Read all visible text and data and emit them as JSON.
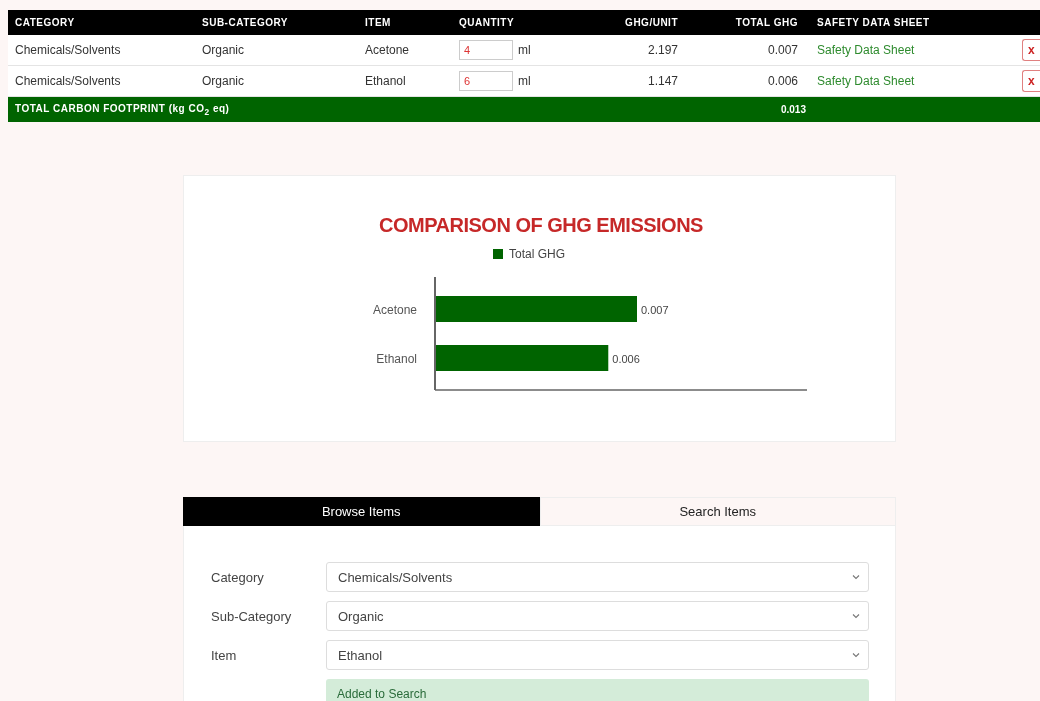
{
  "table": {
    "columns": [
      "CATEGORY",
      "SUB-CATEGORY",
      "ITEM",
      "QUANTITY",
      "GHG/UNIT",
      "TOTAL GHG",
      "SAFETY DATA SHEET"
    ],
    "rows": [
      {
        "category": "Chemicals/Solvents",
        "sub_category": "Organic",
        "item": "Acetone",
        "quantity": "4",
        "unit": "ml",
        "ghg_unit": "2.197",
        "total_ghg": "0.007",
        "sds_link": "Safety Data Sheet",
        "delete": "x"
      },
      {
        "category": "Chemicals/Solvents",
        "sub_category": "Organic",
        "item": "Ethanol",
        "quantity": "6",
        "unit": "ml",
        "ghg_unit": "1.147",
        "total_ghg": "0.006",
        "sds_link": "Safety Data Sheet",
        "delete": "x"
      }
    ],
    "total": {
      "label": "TOTAL CARBON FOOTPRINT (kg CO$_{2}$ eq)",
      "value": "0.013"
    }
  },
  "chart": {
    "chart_data": {
      "type": "bar",
      "orientation": "horizontal",
      "title": "COMPARISON OF GHG EMISSIONS",
      "categories": [
        "Acetone",
        "Ethanol"
      ],
      "series": [
        {
          "name": "Total GHG",
          "color": "#006400",
          "values": [
            0.007,
            0.006
          ]
        }
      ],
      "data_labels": true
    }
  },
  "tabs": [
    {
      "label": "Browse Items",
      "selected": true
    },
    {
      "label": "Search Items",
      "selected": false
    }
  ],
  "form": {
    "fields": [
      {
        "label": "Category",
        "value": "Chemicals/Solvents"
      },
      {
        "label": "Sub-Category",
        "value": "Organic"
      },
      {
        "label": "Item",
        "value": "Ethanol"
      }
    ],
    "alert": "Added to Search"
  }
}
